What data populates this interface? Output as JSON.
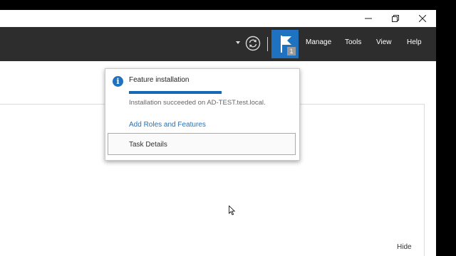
{
  "titlebar": {
    "buttons": [
      "minimize-icon",
      "restore-icon",
      "close-icon"
    ]
  },
  "toolbar": {
    "icons": [
      "chevron-down-icon",
      "refresh-icon",
      "flag-icon"
    ],
    "notification_count": "1",
    "menu": [
      "Manage",
      "Tools",
      "View",
      "Help"
    ],
    "accent_color": "#1e72bf"
  },
  "notification": {
    "icon": "info-icon",
    "title": "Feature installation",
    "progress": 1.0,
    "status": "Installation succeeded on AD-TEST.test.local.",
    "link": "Add Roles and Features",
    "task_button": "Task Details"
  },
  "main": {
    "hide_label": "Hide"
  }
}
